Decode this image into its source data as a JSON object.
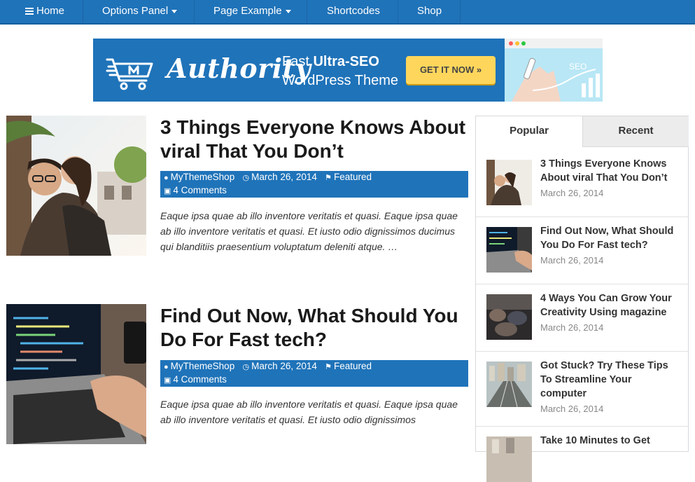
{
  "nav": {
    "items": [
      {
        "label": "Home",
        "icon": "menu-icon"
      },
      {
        "label": "Options Panel",
        "dropdown": true
      },
      {
        "label": "Page Example",
        "dropdown": true
      },
      {
        "label": "Shortcodes"
      },
      {
        "label": "Shop"
      }
    ]
  },
  "banner": {
    "brand": "Authority",
    "tagline_prefix": "Fast ",
    "tagline_strong": "Ultra-SEO",
    "tagline_line2": "WordPress Theme",
    "cta": "GET IT NOW »",
    "mock_label": "SEO"
  },
  "posts": [
    {
      "title": "3 Things Everyone Knows About viral That You Don’t",
      "author": "MyThemeShop",
      "date": "March 26, 2014",
      "category": "Featured",
      "comments": "4 Comments",
      "excerpt": "Eaque ipsa quae ab illo inventore veritatis et quasi. Eaque ipsa quae ab illo inventore veritatis et quasi. Et iusto odio dignissimos ducimus qui blanditiis praesentium voluptatum deleniti atque. …"
    },
    {
      "title": "Find Out Now, What Should You Do For Fast tech?",
      "author": "MyThemeShop",
      "date": "March 26, 2014",
      "category": "Featured",
      "comments": "4 Comments",
      "excerpt": "Eaque ipsa quae ab illo inventore veritatis et quasi. Eaque ipsa quae ab illo inventore veritatis et quasi. Et iusto odio dignissimos"
    }
  ],
  "sidebar": {
    "tabs": [
      {
        "label": "Popular",
        "active": true
      },
      {
        "label": "Recent",
        "active": false
      }
    ],
    "items": [
      {
        "title": "3 Things Everyone Knows About viral That You Don’t",
        "date": "March 26, 2014"
      },
      {
        "title": "Find Out Now, What Should You Do For Fast tech?",
        "date": "March 26, 2014"
      },
      {
        "title": "4 Ways You Can Grow Your Creativity Using magazine",
        "date": "March 26, 2014"
      },
      {
        "title": "Got Stuck? Try These Tips To Streamline Your computer",
        "date": "March 26, 2014"
      },
      {
        "title": "Take 10 Minutes to Get",
        "date": ""
      }
    ]
  },
  "colors": {
    "primary": "#1f73b9",
    "cta": "#ffd65c"
  }
}
